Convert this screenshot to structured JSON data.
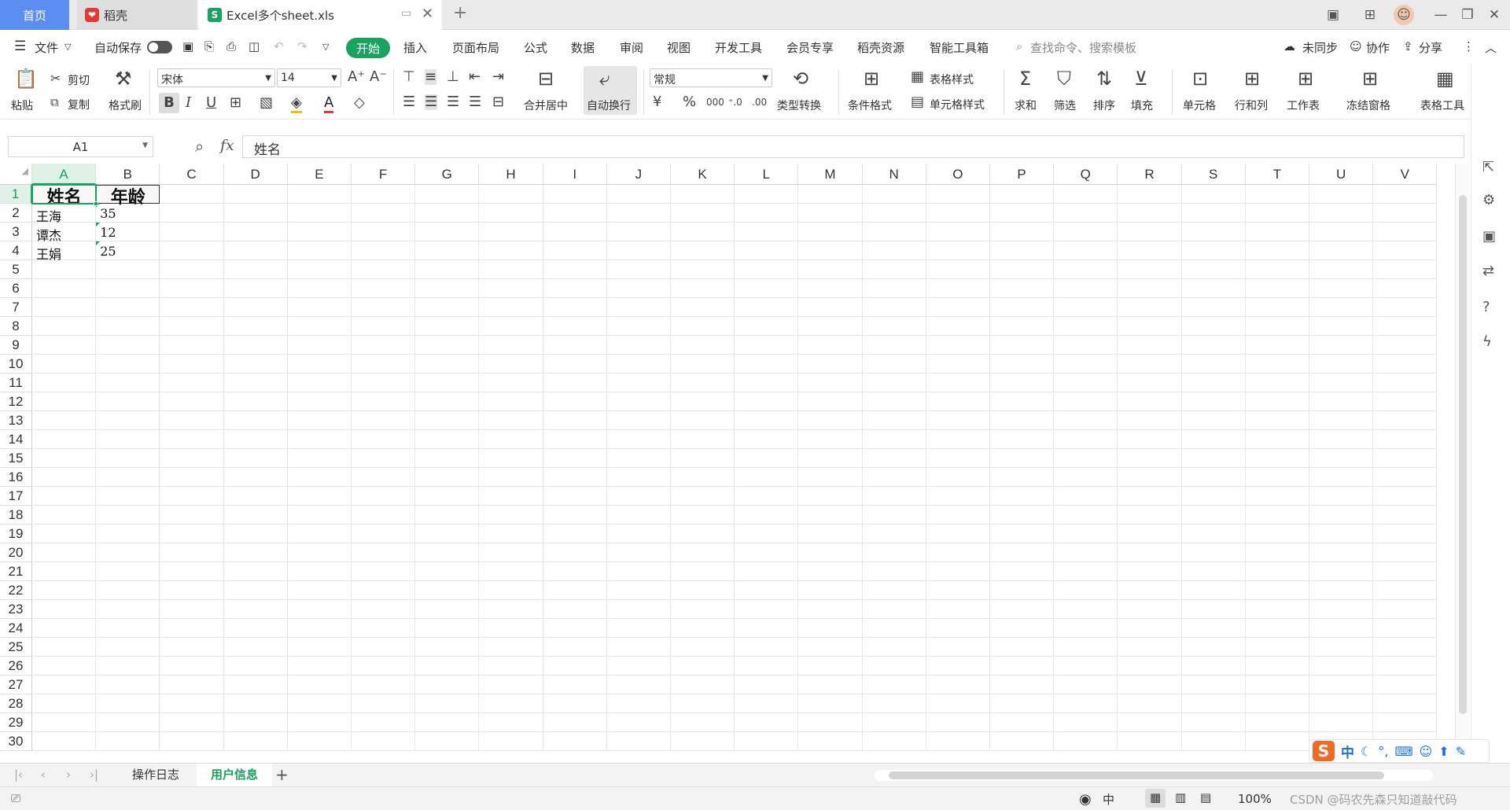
{
  "tabs": {
    "home": "首页",
    "daoke": "稻壳",
    "file": "Excel多个sheet.xls"
  },
  "menu": {
    "file": "文件",
    "autosave": "自动保存",
    "items": [
      "开始",
      "插入",
      "页面布局",
      "公式",
      "数据",
      "审阅",
      "视图",
      "开发工具",
      "会员专享",
      "稻壳资源",
      "智能工具箱"
    ],
    "search_placeholder": "查找命令、搜索模板",
    "not_synced": "未同步",
    "collab": "协作",
    "share": "分享"
  },
  "ribbon": {
    "paste": "粘贴",
    "cut": "剪切",
    "copy": "复制",
    "format_painter": "格式刷",
    "font_name": "宋体",
    "font_size": "14",
    "merge_center": "合并居中",
    "wrap_text": "自动换行",
    "number_format": "常规",
    "type_convert": "类型转换",
    "cond_format": "条件格式",
    "table_style": "表格样式",
    "cell_style": "单元格样式",
    "sum": "求和",
    "filter": "筛选",
    "sort": "排序",
    "fill": "填充",
    "cell": "单元格",
    "row_col": "行和列",
    "worksheet": "工作表",
    "freeze": "冻结窗格",
    "table_tools": "表格工具"
  },
  "formula": {
    "name_box": "A1",
    "value": "姓名",
    "fx": "fx"
  },
  "columns": [
    "A",
    "B",
    "C",
    "D",
    "E",
    "F",
    "G",
    "H",
    "I",
    "J",
    "K",
    "L",
    "M",
    "N",
    "O",
    "P",
    "Q",
    "R",
    "S",
    "T",
    "U",
    "V"
  ],
  "row_count": 30,
  "cells": {
    "A1": "姓名",
    "B1": "年龄",
    "A2": "王海",
    "B2": "35",
    "A3": "谭杰",
    "B3": "12",
    "A4": "王娟",
    "B4": "25"
  },
  "sheet_tabs": [
    "操作日志",
    "用户信息"
  ],
  "active_sheet": "用户信息",
  "status": {
    "zoom": "100%",
    "input_mode": "中",
    "ime_label": "中",
    "watermark": "CSDN @码农先森只知道敲代码"
  },
  "colors": {
    "accent": "#1aa260",
    "home_tab": "#5b8ef0",
    "selection": "#1aa260"
  }
}
